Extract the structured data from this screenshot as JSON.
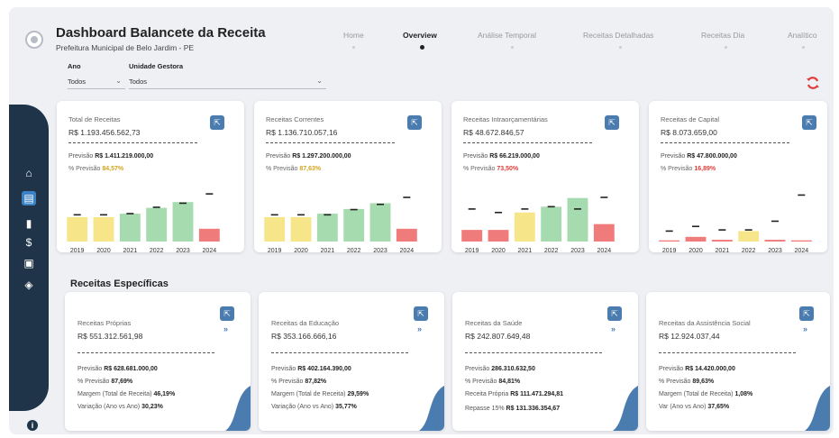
{
  "header": {
    "title": "Dashboard Balancete da Receita",
    "subtitle": "Prefeitura Municipal de Belo Jardim - PE"
  },
  "nav": {
    "items": [
      "Home",
      "Overview",
      "Análise Temporal",
      "Receitas Detalhadas",
      "Receitas Dia",
      "Analítico"
    ],
    "active": "Overview"
  },
  "filters": {
    "ano_label": "Ano",
    "ano_value": "Todos",
    "unidade_label": "Unidade Gestora",
    "unidade_value": "Todos"
  },
  "colors": {
    "yellow": "#f7e58a",
    "green": "#a6dbb0",
    "red": "#f07b7b",
    "accent": "#4a7cb0",
    "sidebar": "#1f3448"
  },
  "icons": {
    "sidebar": [
      "home-icon",
      "dashboard-icon",
      "bar-chart-icon",
      "dollar-icon",
      "calendar-icon",
      "layers-icon"
    ],
    "info": "info-icon",
    "refresh": "refresh-icon",
    "expand": "expand-icon",
    "more": "double-chevron-icon"
  },
  "kpis": [
    {
      "title": "Total de Receitas",
      "value": "R$ 1.193.456.562,73",
      "prev_label": "Previsão",
      "prev_value": "R$ 1.411.219.000,00",
      "pct_label": "% Previsão",
      "pct_value": "84,57%",
      "pct_color": "#d4a520"
    },
    {
      "title": "Receitas Correntes",
      "value": "R$ 1.136.710.057,16",
      "prev_label": "Previsão",
      "prev_value": "R$ 1.297.200.000,00",
      "pct_label": "% Previsão",
      "pct_value": "87,63%",
      "pct_color": "#d4a520"
    },
    {
      "title": "Receitas Intraorçamentárias",
      "value": "R$ 48.672.846,57",
      "prev_label": "Previsão",
      "prev_value": "R$ 66.219.000,00",
      "pct_label": "% Previsão",
      "pct_value": "73,50%",
      "pct_color": "#e03c3c"
    },
    {
      "title": "Receitas de Capital",
      "value": "R$ 8.073.659,00",
      "prev_label": "Previsão",
      "prev_value": "R$ 47.800.000,00",
      "pct_label": "% Previsão",
      "pct_value": "16,89%",
      "pct_color": "#e03c3c"
    }
  ],
  "chart_data": [
    {
      "type": "bar",
      "categories": [
        "2019",
        "2020",
        "2021",
        "2022",
        "2023",
        "2024"
      ],
      "values": [
        42,
        42,
        48,
        58,
        68,
        22
      ],
      "targets": [
        46,
        46,
        48,
        59,
        66,
        82
      ],
      "colors": [
        "yellow",
        "yellow",
        "green",
        "green",
        "green",
        "red"
      ],
      "ylim": [
        0,
        90
      ]
    },
    {
      "type": "bar",
      "categories": [
        "2019",
        "2020",
        "2021",
        "2022",
        "2023",
        "2024"
      ],
      "values": [
        42,
        42,
        48,
        56,
        66,
        22
      ],
      "targets": [
        46,
        46,
        46,
        55,
        64,
        76
      ],
      "colors": [
        "yellow",
        "yellow",
        "green",
        "green",
        "green",
        "red"
      ],
      "ylim": [
        0,
        90
      ]
    },
    {
      "type": "bar",
      "categories": [
        "2019",
        "2020",
        "2021",
        "2022",
        "2023",
        "2024"
      ],
      "values": [
        20,
        20,
        50,
        60,
        75,
        30
      ],
      "targets": [
        56,
        50,
        56,
        60,
        56,
        76
      ],
      "colors": [
        "red",
        "red",
        "yellow",
        "green",
        "green",
        "red"
      ],
      "ylim": [
        0,
        90
      ]
    },
    {
      "type": "bar",
      "categories": [
        "2019",
        "2020",
        "2021",
        "2022",
        "2023",
        "2024"
      ],
      "values": [
        2,
        8,
        3,
        18,
        3,
        2
      ],
      "targets": [
        18,
        26,
        20,
        20,
        35,
        80
      ],
      "colors": [
        "red",
        "red",
        "red",
        "yellow",
        "red",
        "red"
      ],
      "ylim": [
        0,
        90
      ]
    }
  ],
  "section": {
    "title": "Receitas Específicas"
  },
  "specific": [
    {
      "title": "Receitas Próprias",
      "value": "R$ 551.312.561,98",
      "lines": [
        {
          "label": "Previsão",
          "value": "R$ 628.681.000,00"
        },
        {
          "label": "% Previsão",
          "value": "87,69%"
        },
        {
          "label": "Margem (Total de Receita)",
          "value": "46,19%"
        },
        {
          "label": "Variação (Ano vs Ano)",
          "value": "30,23%"
        }
      ]
    },
    {
      "title": "Receitas da Educação",
      "value": "R$ 353.166.666,16",
      "lines": [
        {
          "label": "Previsão",
          "value": "R$ 402.164.390,00"
        },
        {
          "label": "% Previsão",
          "value": "87,82%"
        },
        {
          "label": "Margem (Total de Receita)",
          "value": "29,59%"
        },
        {
          "label": "Variação (Ano vs Ano)",
          "value": "35,77%"
        }
      ]
    },
    {
      "title": "Receitas da Saúde",
      "value": "R$ 242.807.649,48",
      "lines": [
        {
          "label": "Previsão",
          "value": "286.310.632,50"
        },
        {
          "label": "% Previsão",
          "value": "84,81%"
        },
        {
          "label": "Receita Própria",
          "value": "R$ 111.471.294,81"
        },
        {
          "label": "Repasse 15%",
          "value": "R$ 131.336.354,67"
        }
      ]
    },
    {
      "title": "Receitas da Assistência Social",
      "value": "R$ 12.924.037,44",
      "lines": [
        {
          "label": "Previsão",
          "value": "R$ 14.420.000,00"
        },
        {
          "label": "% Previsão",
          "value": "89,63%"
        },
        {
          "label": "Margem (Total de Receita)",
          "value": "1,08%"
        },
        {
          "label": "Var (Ano vs Ano)",
          "value": "37,65%"
        }
      ]
    }
  ]
}
